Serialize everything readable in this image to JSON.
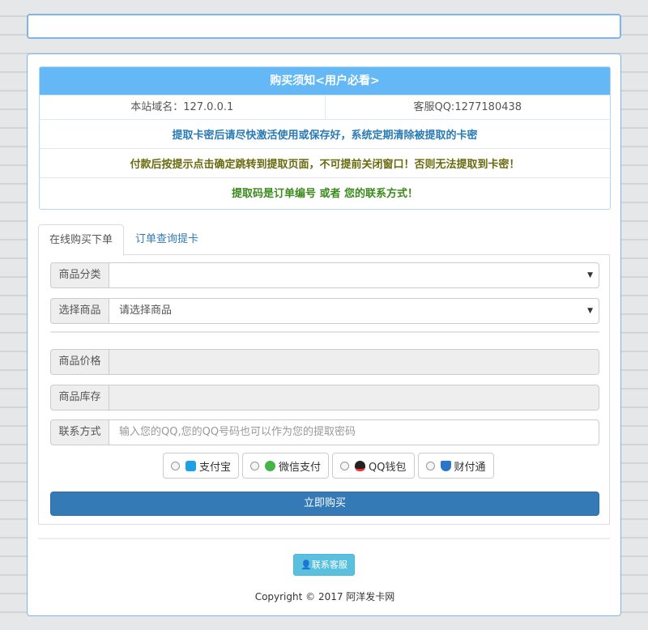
{
  "notice": {
    "title": "购买须知<用户必看>",
    "domain": "本站域名：127.0.0.1",
    "qq": "客服QQ:1277180438",
    "line1": "提取卡密后请尽快激活使用或保存好，系统定期清除被提取的卡密",
    "line2": "付款后按提示点击确定跳转到提取页面，不可提前关闭窗口！否则无法提取到卡密！",
    "line3": "提取码是订单编号 或者 您的联系方式！"
  },
  "tabs": {
    "active": "在线购买下单",
    "other": "订单查询提卡"
  },
  "form": {
    "category_label": "商品分类",
    "category_value": "",
    "product_label": "选择商品",
    "product_value": "请选择商品",
    "price_label": "商品价格",
    "stock_label": "商品库存",
    "contact_label": "联系方式",
    "contact_placeholder": "输入您的QQ,您的QQ号码也可以作为您的提取密码"
  },
  "payments": [
    {
      "label": "支付宝",
      "icon": "alipay-icon",
      "color": "#1ea0e6"
    },
    {
      "label": "微信支付",
      "icon": "wechat-icon",
      "color": "#44b549"
    },
    {
      "label": "QQ钱包",
      "icon": "qq-penguin-icon",
      "color": "#222222"
    },
    {
      "label": "财付通",
      "icon": "tenpay-shield-icon",
      "color": "#2b76c8"
    }
  ],
  "buy_button": "立即购买",
  "contact_button": "联系客服",
  "copyright": "Copyright © 2017 阿洋发卡网",
  "colors": {
    "notice_header": "#63b8f5",
    "primary": "#337ab7",
    "info": "#5bc0de"
  }
}
